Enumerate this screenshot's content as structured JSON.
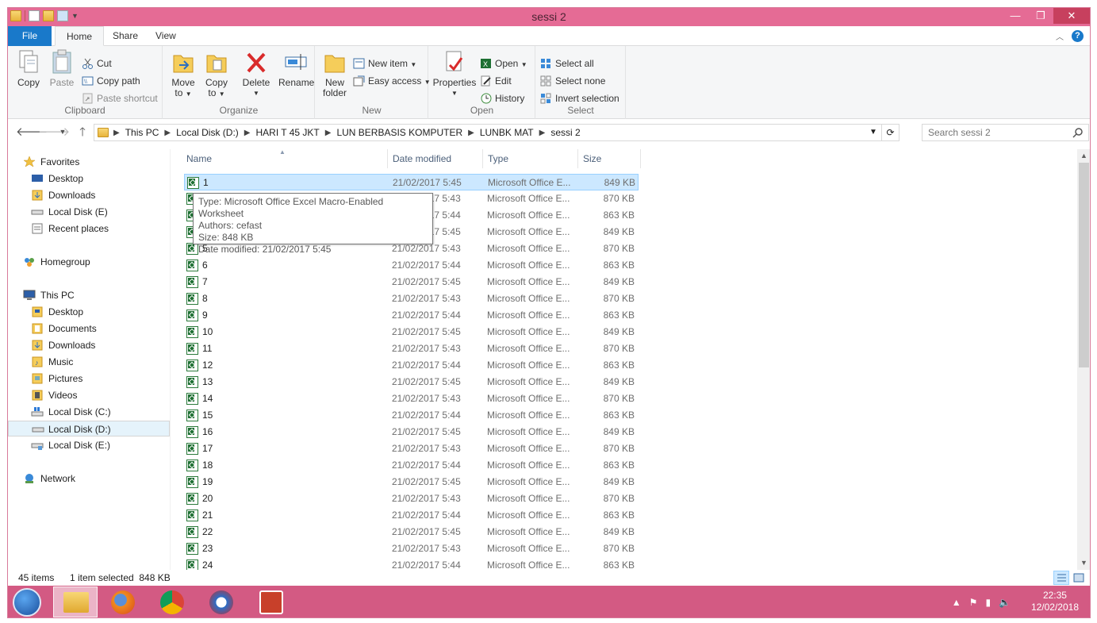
{
  "window": {
    "title": "sessi 2"
  },
  "tabs": {
    "file": "File",
    "home": "Home",
    "share": "Share",
    "view": "View"
  },
  "ribbon": {
    "clipboard": {
      "label": "Clipboard",
      "copy": "Copy",
      "paste": "Paste",
      "cut": "Cut",
      "copy_path": "Copy path",
      "paste_shortcut": "Paste shortcut"
    },
    "organize": {
      "label": "Organize",
      "move_to": "Move",
      "move_to2": "to",
      "copy_to": "Copy",
      "copy_to2": "to",
      "delete": "Delete",
      "rename": "Rename"
    },
    "new": {
      "label": "New",
      "new_folder": "New",
      "new_folder2": "folder",
      "new_item": "New item",
      "easy_access": "Easy access"
    },
    "open": {
      "label": "Open",
      "properties": "Properties",
      "open": "Open",
      "edit": "Edit",
      "history": "History"
    },
    "select": {
      "label": "Select",
      "select_all": "Select all",
      "select_none": "Select none",
      "invert": "Invert selection"
    }
  },
  "address": {
    "crumbs": [
      "This PC",
      "Local Disk (D:)",
      "HARI T 45 JKT",
      "LUN BERBASIS KOMPUTER",
      "LUNBK MAT",
      "sessi 2"
    ],
    "search_placeholder": "Search sessi 2"
  },
  "nav": {
    "favorites": "Favorites",
    "fav_items": [
      "Desktop",
      "Downloads",
      "Local Disk (E)",
      "Recent places"
    ],
    "homegroup": "Homegroup",
    "thispc": "This PC",
    "pc_items": [
      "Desktop",
      "Documents",
      "Downloads",
      "Music",
      "Pictures",
      "Videos",
      "Local Disk (C:)",
      "Local Disk (D:)",
      "Local Disk (E:)"
    ],
    "network": "Network"
  },
  "columns": {
    "name": "Name",
    "date": "Date modified",
    "type": "Type",
    "size": "Size"
  },
  "files": [
    {
      "name": "1",
      "date": "21/02/2017 5:45",
      "type": "Microsoft Office E...",
      "size": "849 KB"
    },
    {
      "name": "2",
      "date": "21/02/2017 5:43",
      "type": "Microsoft Office E...",
      "size": "870 KB"
    },
    {
      "name": "3",
      "date": "21/02/2017 5:44",
      "type": "Microsoft Office E...",
      "size": "863 KB"
    },
    {
      "name": "4",
      "date": "21/02/2017 5:45",
      "type": "Microsoft Office E...",
      "size": "849 KB"
    },
    {
      "name": "5",
      "date": "21/02/2017 5:43",
      "type": "Microsoft Office E...",
      "size": "870 KB"
    },
    {
      "name": "6",
      "date": "21/02/2017 5:44",
      "type": "Microsoft Office E...",
      "size": "863 KB"
    },
    {
      "name": "7",
      "date": "21/02/2017 5:45",
      "type": "Microsoft Office E...",
      "size": "849 KB"
    },
    {
      "name": "8",
      "date": "21/02/2017 5:43",
      "type": "Microsoft Office E...",
      "size": "870 KB"
    },
    {
      "name": "9",
      "date": "21/02/2017 5:44",
      "type": "Microsoft Office E...",
      "size": "863 KB"
    },
    {
      "name": "10",
      "date": "21/02/2017 5:45",
      "type": "Microsoft Office E...",
      "size": "849 KB"
    },
    {
      "name": "11",
      "date": "21/02/2017 5:43",
      "type": "Microsoft Office E...",
      "size": "870 KB"
    },
    {
      "name": "12",
      "date": "21/02/2017 5:44",
      "type": "Microsoft Office E...",
      "size": "863 KB"
    },
    {
      "name": "13",
      "date": "21/02/2017 5:45",
      "type": "Microsoft Office E...",
      "size": "849 KB"
    },
    {
      "name": "14",
      "date": "21/02/2017 5:43",
      "type": "Microsoft Office E...",
      "size": "870 KB"
    },
    {
      "name": "15",
      "date": "21/02/2017 5:44",
      "type": "Microsoft Office E...",
      "size": "863 KB"
    },
    {
      "name": "16",
      "date": "21/02/2017 5:45",
      "type": "Microsoft Office E...",
      "size": "849 KB"
    },
    {
      "name": "17",
      "date": "21/02/2017 5:43",
      "type": "Microsoft Office E...",
      "size": "870 KB"
    },
    {
      "name": "18",
      "date": "21/02/2017 5:44",
      "type": "Microsoft Office E...",
      "size": "863 KB"
    },
    {
      "name": "19",
      "date": "21/02/2017 5:45",
      "type": "Microsoft Office E...",
      "size": "849 KB"
    },
    {
      "name": "20",
      "date": "21/02/2017 5:43",
      "type": "Microsoft Office E...",
      "size": "870 KB"
    },
    {
      "name": "21",
      "date": "21/02/2017 5:44",
      "type": "Microsoft Office E...",
      "size": "863 KB"
    },
    {
      "name": "22",
      "date": "21/02/2017 5:45",
      "type": "Microsoft Office E...",
      "size": "849 KB"
    },
    {
      "name": "23",
      "date": "21/02/2017 5:43",
      "type": "Microsoft Office E...",
      "size": "870 KB"
    },
    {
      "name": "24",
      "date": "21/02/2017 5:44",
      "type": "Microsoft Office E...",
      "size": "863 KB"
    }
  ],
  "tooltip": {
    "type": "Type: Microsoft Office Excel Macro-Enabled Worksheet",
    "authors": "Authors: cefast",
    "size": "Size: 848 KB",
    "date": "Date modified: 21/02/2017 5:45"
  },
  "status": {
    "items": "45 items",
    "selected": "1 item selected  848 KB"
  },
  "taskbar": {
    "time": "22:35",
    "date": "12/02/2018"
  },
  "colors": {
    "accent": "#e56b95",
    "taskbar": "#d35a83",
    "file_tab": "#1979ca",
    "selection": "#cce8ff"
  }
}
